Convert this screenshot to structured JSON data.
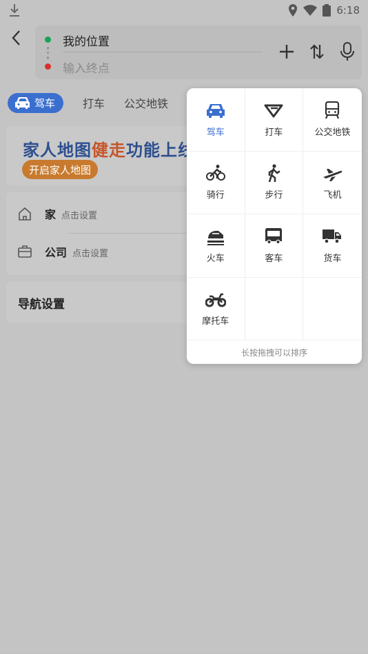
{
  "status_bar": {
    "time": "6:18",
    "icons": [
      "download-icon",
      "location-icon",
      "wifi-icon",
      "battery-icon"
    ]
  },
  "route": {
    "start": "我的位置",
    "end_placeholder": "输入终点"
  },
  "modes": {
    "active": "驾车",
    "tabs": [
      "打车",
      "公交地铁"
    ]
  },
  "banner": {
    "title_part1": "家人地图",
    "title_highlight": "健走",
    "title_part2": "功能上线",
    "button": "开启家人地图"
  },
  "places": [
    {
      "name": "家",
      "sub": "点击设置",
      "icon": "home-icon"
    },
    {
      "name": "公司",
      "sub": "点击设置",
      "icon": "briefcase-icon"
    }
  ],
  "nav_settings": "导航设置",
  "popup": {
    "items": [
      {
        "label": "驾车",
        "icon": "car-icon",
        "active": true
      },
      {
        "label": "打车",
        "icon": "taxi-icon",
        "active": false
      },
      {
        "label": "公交地铁",
        "icon": "bus-icon",
        "active": false
      },
      {
        "label": "骑行",
        "icon": "cycling-icon",
        "active": false
      },
      {
        "label": "步行",
        "icon": "walking-icon",
        "active": false
      },
      {
        "label": "飞机",
        "icon": "airplane-icon",
        "active": false
      },
      {
        "label": "火车",
        "icon": "train-icon",
        "active": false
      },
      {
        "label": "客车",
        "icon": "coach-icon",
        "active": false
      },
      {
        "label": "货车",
        "icon": "truck-icon",
        "active": false
      },
      {
        "label": "摩托车",
        "icon": "motorcycle-icon",
        "active": false
      }
    ],
    "hint": "长按拖拽可以排序"
  },
  "colors": {
    "accent": "#3b6fcf",
    "start_dot": "#17a35a",
    "end_dot": "#d9302c"
  }
}
